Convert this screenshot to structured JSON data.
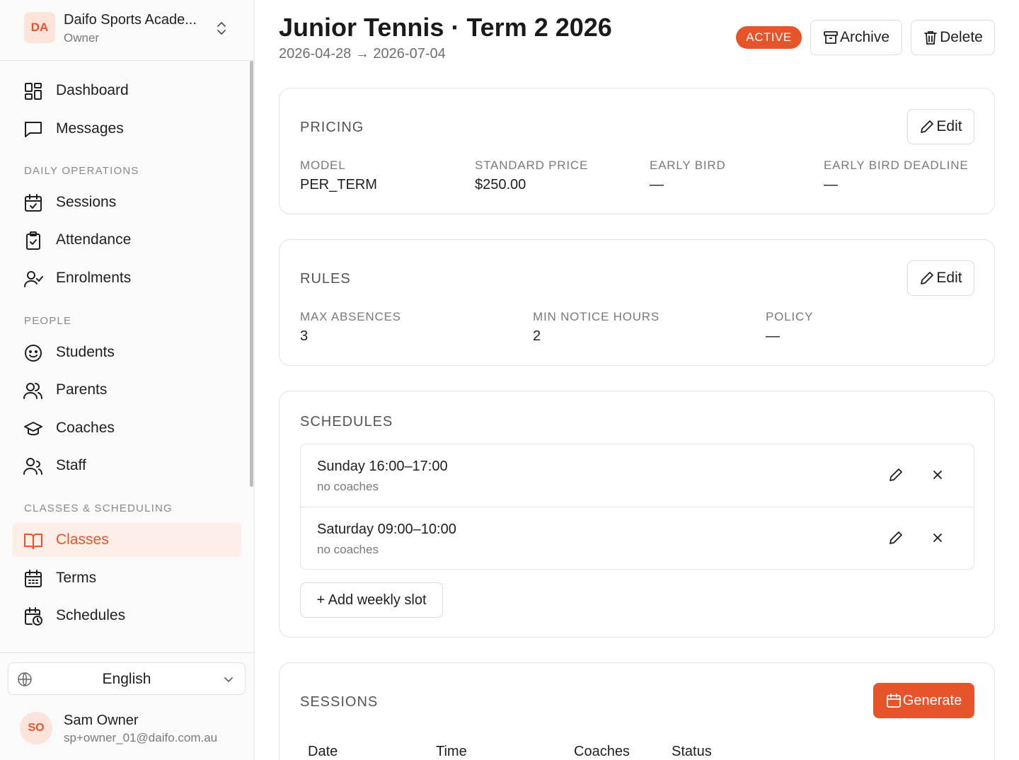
{
  "org": {
    "initials": "DA",
    "name": "Daifo Sports Acade...",
    "role": "Owner"
  },
  "nav": {
    "dashboard": "Dashboard",
    "messages": "Messages",
    "daily_operations": "DAILY OPERATIONS",
    "sessions": "Sessions",
    "attendance": "Attendance",
    "enrolments": "Enrolments",
    "people": "PEOPLE",
    "students": "Students",
    "parents": "Parents",
    "coaches": "Coaches",
    "staff": "Staff",
    "classes_scheduling": "CLASSES & SCHEDULING",
    "classes": "Classes",
    "terms": "Terms",
    "schedules": "Schedules"
  },
  "language": {
    "value": "English"
  },
  "user": {
    "initials": "SO",
    "name": "Sam Owner",
    "email": "sp+owner_01@daifo.com.au"
  },
  "header": {
    "title": "Junior Tennis · Term 2 2026",
    "dates": "2026-04-28 → 2026-07-04",
    "status": "ACTIVE",
    "archive_label": "Archive",
    "delete_label": "Delete"
  },
  "pricing": {
    "title": "PRICING",
    "edit_label": "Edit",
    "fields": [
      {
        "label": "MODEL",
        "value": "PER_TERM"
      },
      {
        "label": "STANDARD PRICE",
        "value": "$250.00"
      },
      {
        "label": "EARLY BIRD",
        "value": "—"
      },
      {
        "label": "EARLY BIRD DEADLINE",
        "value": "—"
      }
    ]
  },
  "rules": {
    "title": "RULES",
    "edit_label": "Edit",
    "fields": [
      {
        "label": "MAX ABSENCES",
        "value": "3"
      },
      {
        "label": "MIN NOTICE HOURS",
        "value": "2"
      },
      {
        "label": "POLICY",
        "value": "—"
      }
    ]
  },
  "schedules": {
    "title": "SCHEDULES",
    "items": [
      {
        "title": "Sunday 16:00–17:00",
        "subtitle": "no coaches"
      },
      {
        "title": "Saturday 09:00–10:00",
        "subtitle": "no coaches"
      }
    ],
    "add_label": "+ Add weekly slot"
  },
  "sessions": {
    "title": "SESSIONS",
    "generate_label": "Generate",
    "columns": [
      "Date",
      "Time",
      "Coaches",
      "Status"
    ]
  },
  "colors": {
    "accent": "#e8542a",
    "accent_soft": "#fdeee8"
  }
}
